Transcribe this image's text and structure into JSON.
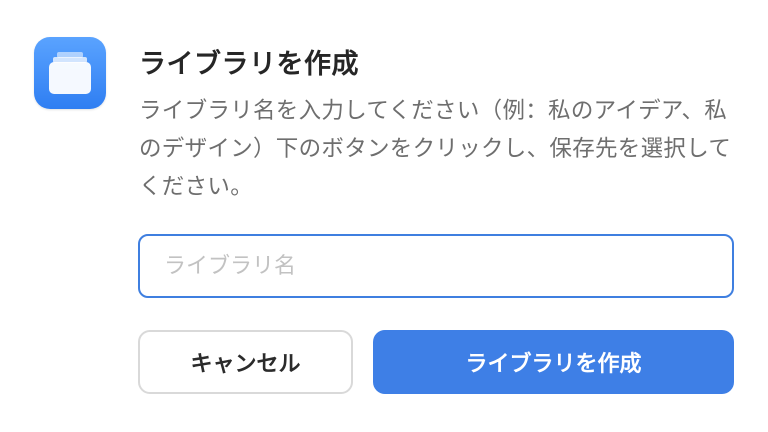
{
  "dialog": {
    "icon": "library-folder-icon",
    "title": "ライブラリを作成",
    "description": "ライブラリ名を入力してください（例：私のアイデア、私のデザイン）下のボタンをクリックし、保存先を選択してください。",
    "input": {
      "value": "",
      "placeholder": "ライブラリ名"
    },
    "buttons": {
      "cancel": "キャンセル",
      "create": "ライブラリを作成"
    }
  },
  "colors": {
    "accent": "#3e7fe6",
    "input_border": "#3f7fe0",
    "icon_gradient_top": "#5aa3ff",
    "icon_gradient_bottom": "#2f7ef2"
  }
}
